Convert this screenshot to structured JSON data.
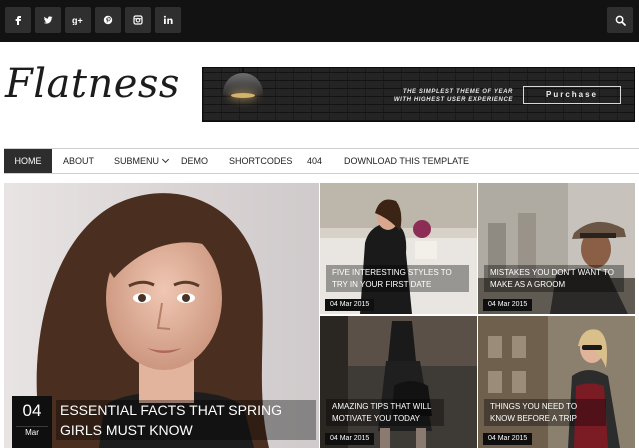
{
  "header": {
    "social": [
      {
        "icon": "facebook-icon",
        "glyph": "f"
      },
      {
        "icon": "twitter-icon",
        "glyph": "t"
      },
      {
        "icon": "google-plus-icon",
        "glyph": "g+"
      },
      {
        "icon": "pinterest-icon",
        "glyph": "p"
      },
      {
        "icon": "instagram-icon",
        "glyph": "ig"
      },
      {
        "icon": "linkedin-icon",
        "glyph": "in"
      }
    ],
    "search_icon": "search-icon"
  },
  "logo": "Flatness",
  "banner": {
    "line1": "The simplest theme of year",
    "line2": "with highest user experience",
    "button": "Purchase"
  },
  "nav": {
    "items": [
      "Home",
      "About",
      "Submenu",
      "Demo",
      "Shortcodes",
      "404",
      "Download This Template"
    ],
    "active": "Home"
  },
  "featured": {
    "main": {
      "title": "Essential facts that spring girls must know",
      "day": "04",
      "month": "Mar"
    },
    "posts": [
      {
        "title": "Five interesting styles to try in your first date",
        "date": "04 Mar 2015"
      },
      {
        "title": "Mistakes you don't want to make as a groom",
        "date": "04 Mar 2015"
      },
      {
        "title": "Amazing tips that will motivate you today",
        "date": "04 Mar 2015"
      },
      {
        "title": "Things you need to know before a trip",
        "date": "04 Mar 2015"
      }
    ]
  },
  "colors": {
    "topbar": "#121212",
    "nav_active": "#2d2d2d",
    "text": "#222222"
  }
}
